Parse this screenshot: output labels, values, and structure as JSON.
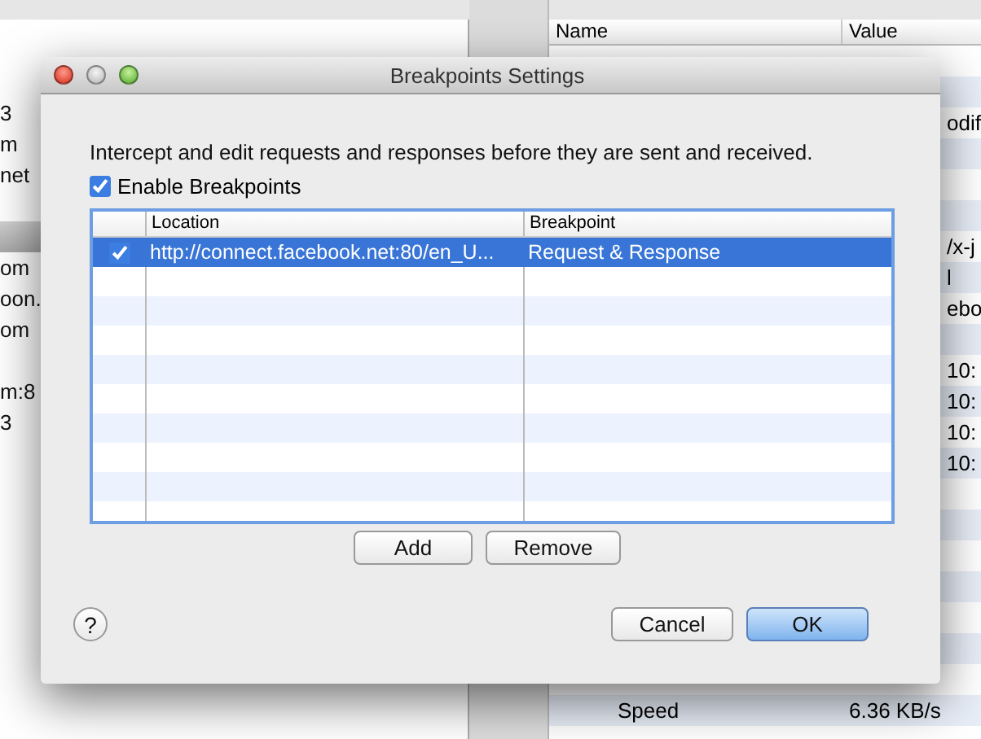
{
  "background": {
    "left_rows": [
      {
        "text": "3",
        "selected": false
      },
      {
        "text": "m",
        "selected": false
      },
      {
        "text": "net",
        "selected": false
      },
      {
        "selected": false
      },
      {
        "selected": true
      },
      {
        "text": "om",
        "selected": false
      },
      {
        "text": "oon.",
        "selected": false
      },
      {
        "text": "om",
        "selected": false
      },
      {
        "selected": false
      },
      {
        "text": "m:8",
        "selected": false
      },
      {
        "text": "3",
        "selected": false
      }
    ],
    "right_columns": [
      "Name",
      "Value"
    ],
    "right_rows": [
      {},
      {},
      {
        "kind": "tail",
        "value": "odif"
      },
      {},
      {},
      {},
      {
        "kind": "tail",
        "value": "/x-j"
      },
      {
        "kind": "tail",
        "value": "l"
      },
      {
        "kind": "tail",
        "value": "ebo"
      },
      {},
      {
        "kind": "tail",
        "value": "10:"
      },
      {
        "kind": "tail",
        "value": "10:"
      },
      {
        "kind": "tail",
        "value": "10:"
      },
      {
        "kind": "tail",
        "value": "10:"
      },
      {},
      {},
      {},
      {},
      {},
      {},
      {},
      {
        "kind": "full",
        "name": "Speed",
        "value": "6.36 KB/s"
      }
    ]
  },
  "dialog": {
    "title": "Breakpoints Settings",
    "description": "Intercept and edit requests and responses before they are sent and received.",
    "enable": {
      "label": "Enable Breakpoints",
      "checked": true
    },
    "table": {
      "columns": [
        "Location",
        "Breakpoint"
      ],
      "rows": [
        {
          "checked": true,
          "selected": true,
          "location": "http://connect.facebook.net:80/en_U...",
          "breakpoint": "Request & Response"
        }
      ]
    },
    "table_buttons": [
      "Add",
      "Remove"
    ],
    "help": "?",
    "buttons": [
      {
        "label": "Cancel",
        "default": false
      },
      {
        "label": "OK",
        "default": true
      }
    ]
  }
}
